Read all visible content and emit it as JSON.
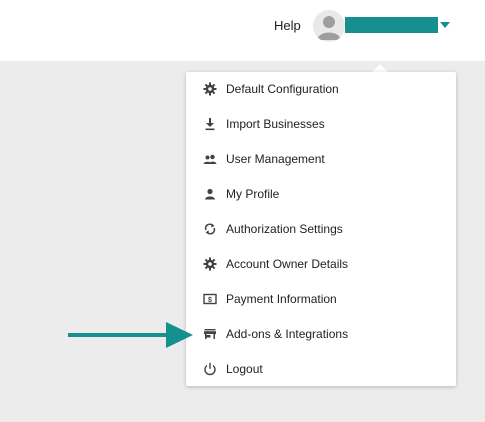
{
  "header": {
    "help_label": "Help",
    "user_name_color": "#168f8f"
  },
  "menu": {
    "items": [
      {
        "label": "Default Configuration",
        "icon": "gear-icon"
      },
      {
        "label": "Import Businesses",
        "icon": "download-icon"
      },
      {
        "label": "User Management",
        "icon": "users-icon"
      },
      {
        "label": "My Profile",
        "icon": "person-icon"
      },
      {
        "label": "Authorization Settings",
        "icon": "sync-icon"
      },
      {
        "label": "Account Owner Details",
        "icon": "gear-icon"
      },
      {
        "label": "Payment Information",
        "icon": "payment-icon"
      },
      {
        "label": "Add-ons & Integrations",
        "icon": "store-icon"
      },
      {
        "label": "Logout",
        "icon": "power-icon"
      }
    ]
  },
  "annotation": {
    "arrow_color": "#168f8f",
    "points_to": "Add-ons & Integrations"
  }
}
